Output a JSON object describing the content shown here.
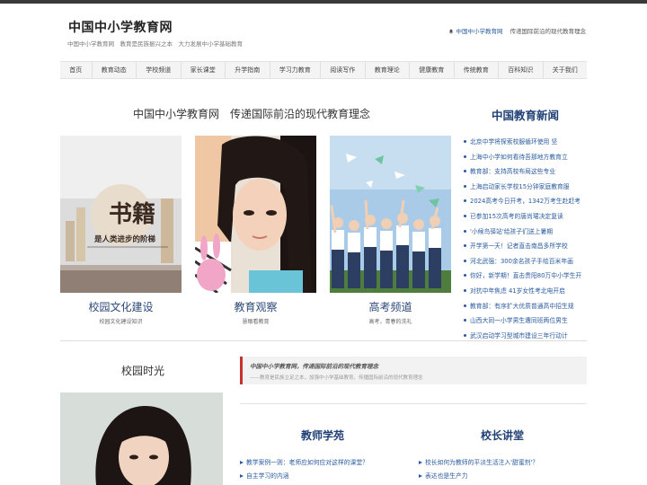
{
  "header": {
    "site_title": "中国中小学教育网",
    "tagline": "中国中小学教育网　教育是民族振兴之本　大力发展中小学基础教育",
    "right_brand": "中国中小学教育网",
    "right_slogan": "传递国际前沿的现代教育理念",
    "icon": "bell-icon"
  },
  "nav": [
    "首页",
    "教育动态",
    "学校频道",
    "家长课堂",
    "升学指南",
    "学习力教育",
    "阅读写作",
    "教育理论",
    "健康教育",
    "传统教育",
    "百科知识",
    "关于我们"
  ],
  "headline": "中国中小学教育网　传递国际前沿的现代教育理念",
  "news": {
    "title": "中国教育新闻",
    "items": [
      "北京中学将探索校服循环使用 坚",
      "上海中小学如何看待吾那地方教育立",
      "教育部：支持高校布局这些专业",
      "上海启动家长学校15分钟家庭教育服",
      "2024高考今日开考，1342万考生赴赶考",
      "已参加15次高考的唐尚珺决定复读",
      "'小候鸟驿站'给孩子们送上暑期",
      "开学第一天！记者直击南昌多所学校",
      "河北武强：300余名孩子手绘百米年画",
      "你好，新学期！直击贵阳80万中小学生开",
      "对抗中年焦虑 41岁女性考北电开启",
      "教育部：有序扩大优质普通高中招生规",
      "山西大同一小学男生遭同班两位男生",
      "武汉启动学习型城市建设三年行动计"
    ]
  },
  "cards": [
    {
      "caption": "校园文化建设",
      "sub": "校园文化建设知识",
      "img_text": "书籍是人类进步的阶梯"
    },
    {
      "caption": "教育观察",
      "sub": "慧眼看教育"
    },
    {
      "caption": "高考频道",
      "sub": "高考，青春的洗礼"
    }
  ],
  "campus": {
    "title": "校园时光"
  },
  "quote": {
    "line1": "中国中小学教育网，传递国际前沿的现代教育理念",
    "line2": "——教育是民族立足之本，加强中小学基础教育，传播国际前沿的现代教育理念"
  },
  "teacher": {
    "title": "教师学苑",
    "items": [
      "教学案例一则：老师应如何应对这样的课堂？",
      "自主学习的内涵"
    ]
  },
  "principal": {
    "title": "校长讲堂",
    "items": [
      "校长如何为教师的平淡生活注入'甜蜜剂'？",
      "表达也是生产力"
    ]
  },
  "colors": {
    "accent_blue": "#1f3f75",
    "link_blue": "#2a5b9f",
    "quote_red": "#c9302c"
  }
}
